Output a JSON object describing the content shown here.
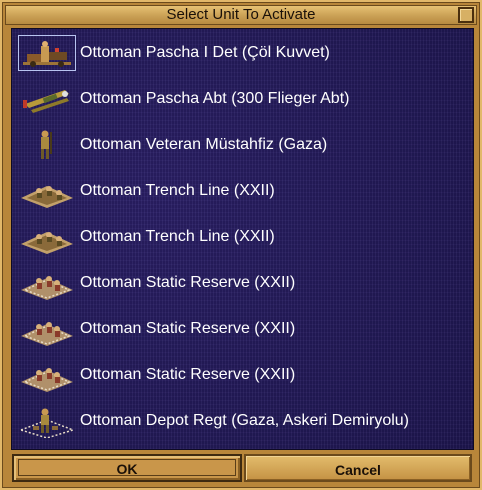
{
  "dialog": {
    "title": "Select Unit To Activate"
  },
  "units": [
    {
      "label": "Ottoman Pascha I Det (Çöl Kuvvet)",
      "icon": "desert-force-icon",
      "selected": true
    },
    {
      "label": "Ottoman Pascha Abt (300 Flieger Abt)",
      "icon": "biplane-icon",
      "selected": false
    },
    {
      "label": "Ottoman Veteran Müstahfiz (Gaza)",
      "icon": "infantry-soldier-icon",
      "selected": false
    },
    {
      "label": "Ottoman Trench Line (XXII)",
      "icon": "trench-line-icon",
      "selected": false
    },
    {
      "label": "Ottoman Trench Line (XXII)",
      "icon": "trench-line-icon",
      "selected": false
    },
    {
      "label": "Ottoman Static Reserve (XXII)",
      "icon": "static-reserve-icon",
      "selected": false
    },
    {
      "label": "Ottoman Static Reserve (XXII)",
      "icon": "static-reserve-icon",
      "selected": false
    },
    {
      "label": "Ottoman Static Reserve (XXII)",
      "icon": "static-reserve-icon",
      "selected": false
    },
    {
      "label": "Ottoman Depot Regt (Gaza, Askeri Demiryolu)",
      "icon": "depot-regiment-icon",
      "selected": false
    }
  ],
  "buttons": {
    "ok_label": "OK",
    "cancel_label": "Cancel"
  },
  "colors": {
    "panel_background": "#241a5c",
    "frame_gold": "#b8863a",
    "text_white": "#ffffff"
  }
}
